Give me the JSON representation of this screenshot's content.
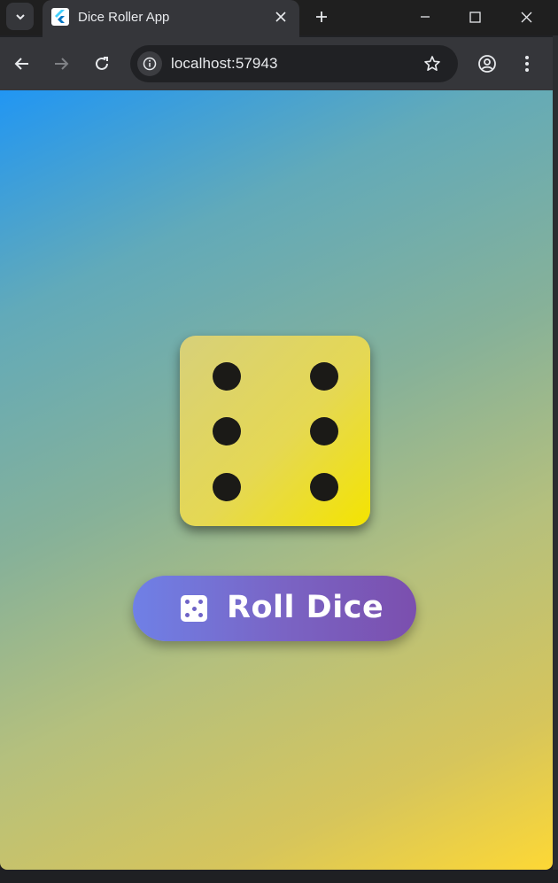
{
  "browser": {
    "tab": {
      "title": "Dice Roller App"
    },
    "address_bar": {
      "url": "localhost:57943"
    }
  },
  "app": {
    "die": {
      "value": 6
    },
    "roll_button": {
      "label": "Roll Dice",
      "icon": "dice-icon"
    }
  },
  "colors": {
    "gradient_start": "#2196f3",
    "gradient_end": "#fdd835",
    "die_face": "#e8de4c",
    "pip": "#1b1a17",
    "button_start": "#6f80e6",
    "button_end": "#7b4fae"
  }
}
